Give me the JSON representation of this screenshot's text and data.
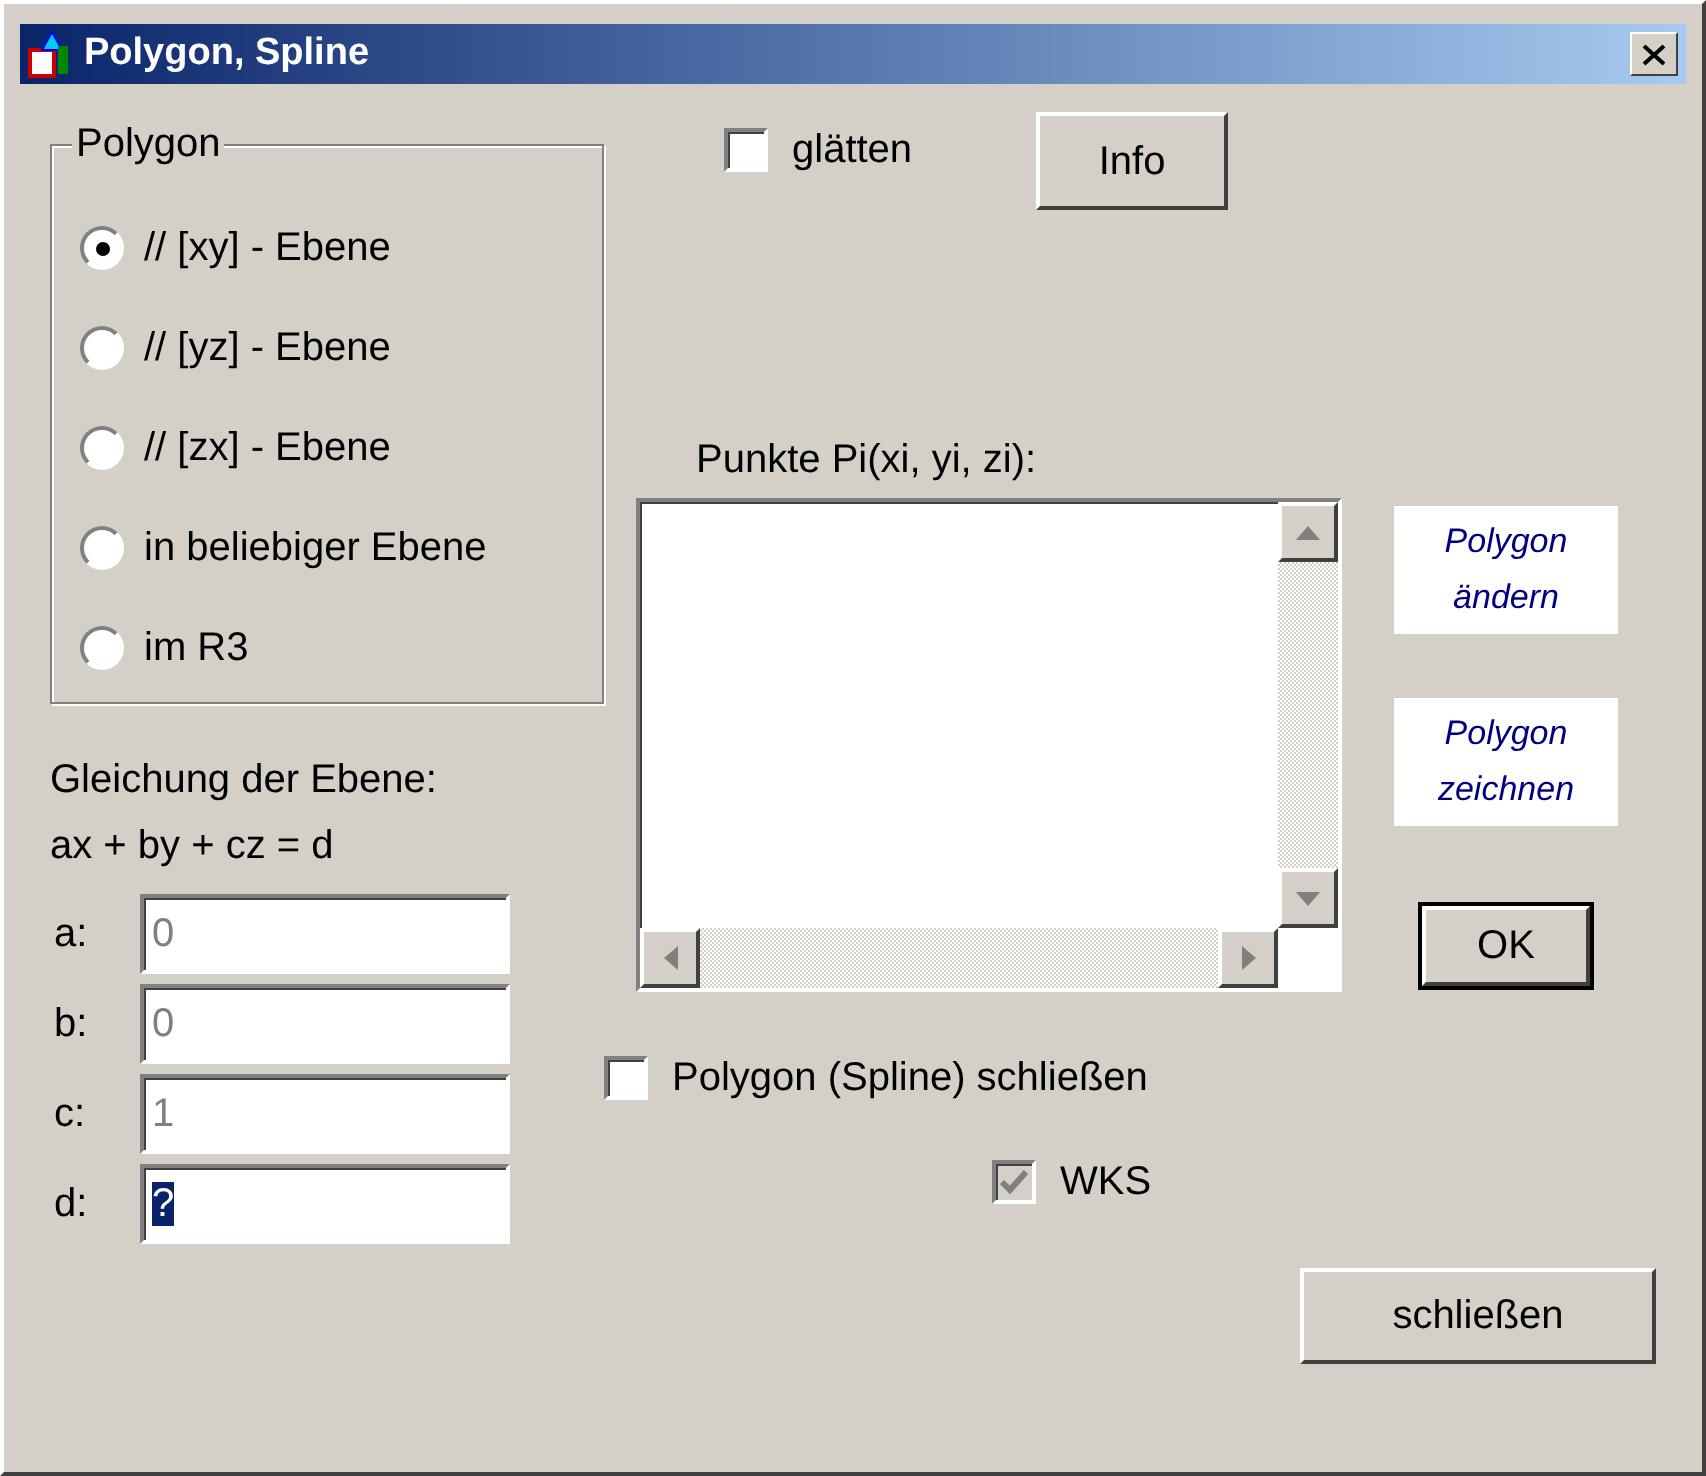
{
  "window": {
    "title": "Polygon, Spline"
  },
  "polygon_group": {
    "label": "Polygon",
    "options": [
      {
        "label": "// [xy] - Ebene",
        "selected": true
      },
      {
        "label": "// [yz] - Ebene",
        "selected": false
      },
      {
        "label": "// [zx] - Ebene",
        "selected": false
      },
      {
        "label": "in beliebiger Ebene",
        "selected": false
      },
      {
        "label": "im R3",
        "selected": false
      }
    ]
  },
  "equation": {
    "heading": "Gleichung der Ebene:",
    "formula": "ax + by + cz = d",
    "fields": [
      {
        "label": "a:",
        "value": "0",
        "disabled": true,
        "text_selected": false
      },
      {
        "label": "b:",
        "value": "0",
        "disabled": true,
        "text_selected": false
      },
      {
        "label": "c:",
        "value": "1",
        "disabled": true,
        "text_selected": false
      },
      {
        "label": "d:",
        "value": "?",
        "disabled": false,
        "text_selected": true
      }
    ]
  },
  "smooth": {
    "label": "glätten",
    "checked": false
  },
  "info_button": {
    "label": "Info",
    "default": false
  },
  "points": {
    "label": "Punkte Pi(xi, yi, zi):"
  },
  "side_buttons": [
    {
      "label": "Polygon ändern"
    },
    {
      "label": "Polygon zeichnen"
    }
  ],
  "ok_button": {
    "label": "OK",
    "default": true
  },
  "close_polygon": {
    "label": "Polygon (Spline) schließen",
    "checked": false,
    "disabled": false
  },
  "wks": {
    "label": "WKS",
    "checked": true,
    "disabled": true
  },
  "close_button": {
    "label": "schließen",
    "default": false
  }
}
